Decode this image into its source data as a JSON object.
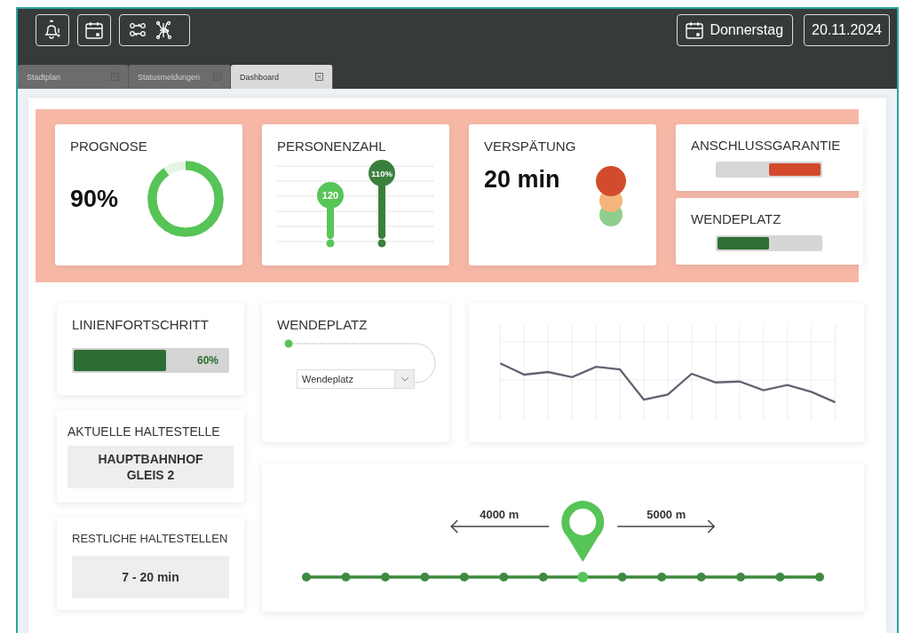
{
  "toolbar": {
    "left_buttons": [
      {
        "kind": "bell"
      },
      {
        "kind": "calendar"
      },
      {
        "kind": "network"
      }
    ],
    "weekday": "Donnerstag",
    "date": "20.11.2024"
  },
  "tabs": [
    {
      "label": "Stadtplan",
      "selected": false
    },
    {
      "label": "Statusmeldungen",
      "selected": false
    },
    {
      "label": "Dashboard",
      "selected": true
    }
  ],
  "prognose": {
    "title": "PROGNOSE",
    "value": "90%",
    "level": 0.9
  },
  "personenzahl": {
    "title": "PERSONENZAHL",
    "pins": [
      {
        "label": "120"
      },
      {
        "label": "110%"
      }
    ]
  },
  "verspaetung": {
    "title": "VERSPÄTUNG",
    "value": "20 min",
    "lights": [
      {
        "on": true
      },
      {
        "on": false
      },
      {
        "on": false
      }
    ]
  },
  "anschlussgarantie": {
    "title": "ANSCHLUSSGARANTIE",
    "level": 0.5
  },
  "wendeplatz_status": {
    "title": "WENDEPLATZ",
    "level": 0.5
  },
  "linienfortschritt": {
    "title": "LINIENFORTSCHRITT",
    "level": 0.6,
    "reading": "60%"
  },
  "aktuelle_haltestelle": {
    "title": "AKTUELLE HALTESTELLE",
    "value_lines": [
      "HAUPTBAHNHOF",
      "GLEIS 2"
    ]
  },
  "restliche_haltestellen": {
    "title": "RESTLICHE HALTESTELLEN",
    "value": "7 - 20 min"
  },
  "wendeplatz": {
    "title": "WENDEPLATZ",
    "select_value": "Wendeplatz"
  },
  "route": {
    "left_distance": "4000 m",
    "right_distance": "5000 m",
    "stops": [
      {
        "current": false
      },
      {
        "current": false
      },
      {
        "current": false
      },
      {
        "current": false
      },
      {
        "current": false
      },
      {
        "current": false
      },
      {
        "current": false
      },
      {
        "current": true
      },
      {
        "current": false
      },
      {
        "current": false
      },
      {
        "current": false
      },
      {
        "current": false
      },
      {
        "current": false
      },
      {
        "current": false
      }
    ]
  }
}
